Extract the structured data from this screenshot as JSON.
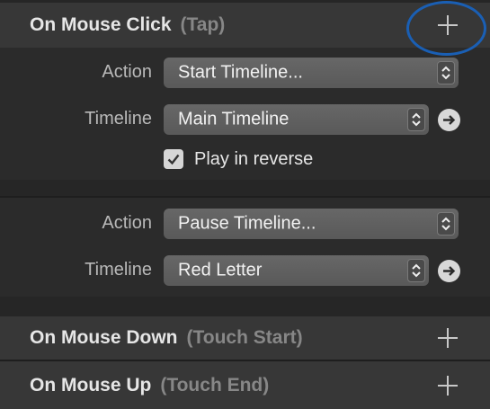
{
  "events": [
    {
      "title": "On Mouse Click",
      "subtitle": "(Tap)"
    },
    {
      "title": "On Mouse Down",
      "subtitle": "(Touch Start)"
    },
    {
      "title": "On Mouse Up",
      "subtitle": "(Touch End)"
    }
  ],
  "actions": [
    {
      "action_label": "Action",
      "action_value": "Start Timeline...",
      "timeline_label": "Timeline",
      "timeline_value": "Main Timeline",
      "checkbox_label": "Play in reverse",
      "checkbox_checked": true
    },
    {
      "action_label": "Action",
      "action_value": "Pause Timeline...",
      "timeline_label": "Timeline",
      "timeline_value": "Red Letter"
    }
  ],
  "icons": {
    "add": "plus-icon",
    "stepper": "up-down-chevron-icon",
    "go": "arrow-right-icon",
    "check": "checkmark-icon"
  },
  "colors": {
    "background": "#262626",
    "header": "#373737",
    "highlight_ring": "#1a5fb4"
  }
}
